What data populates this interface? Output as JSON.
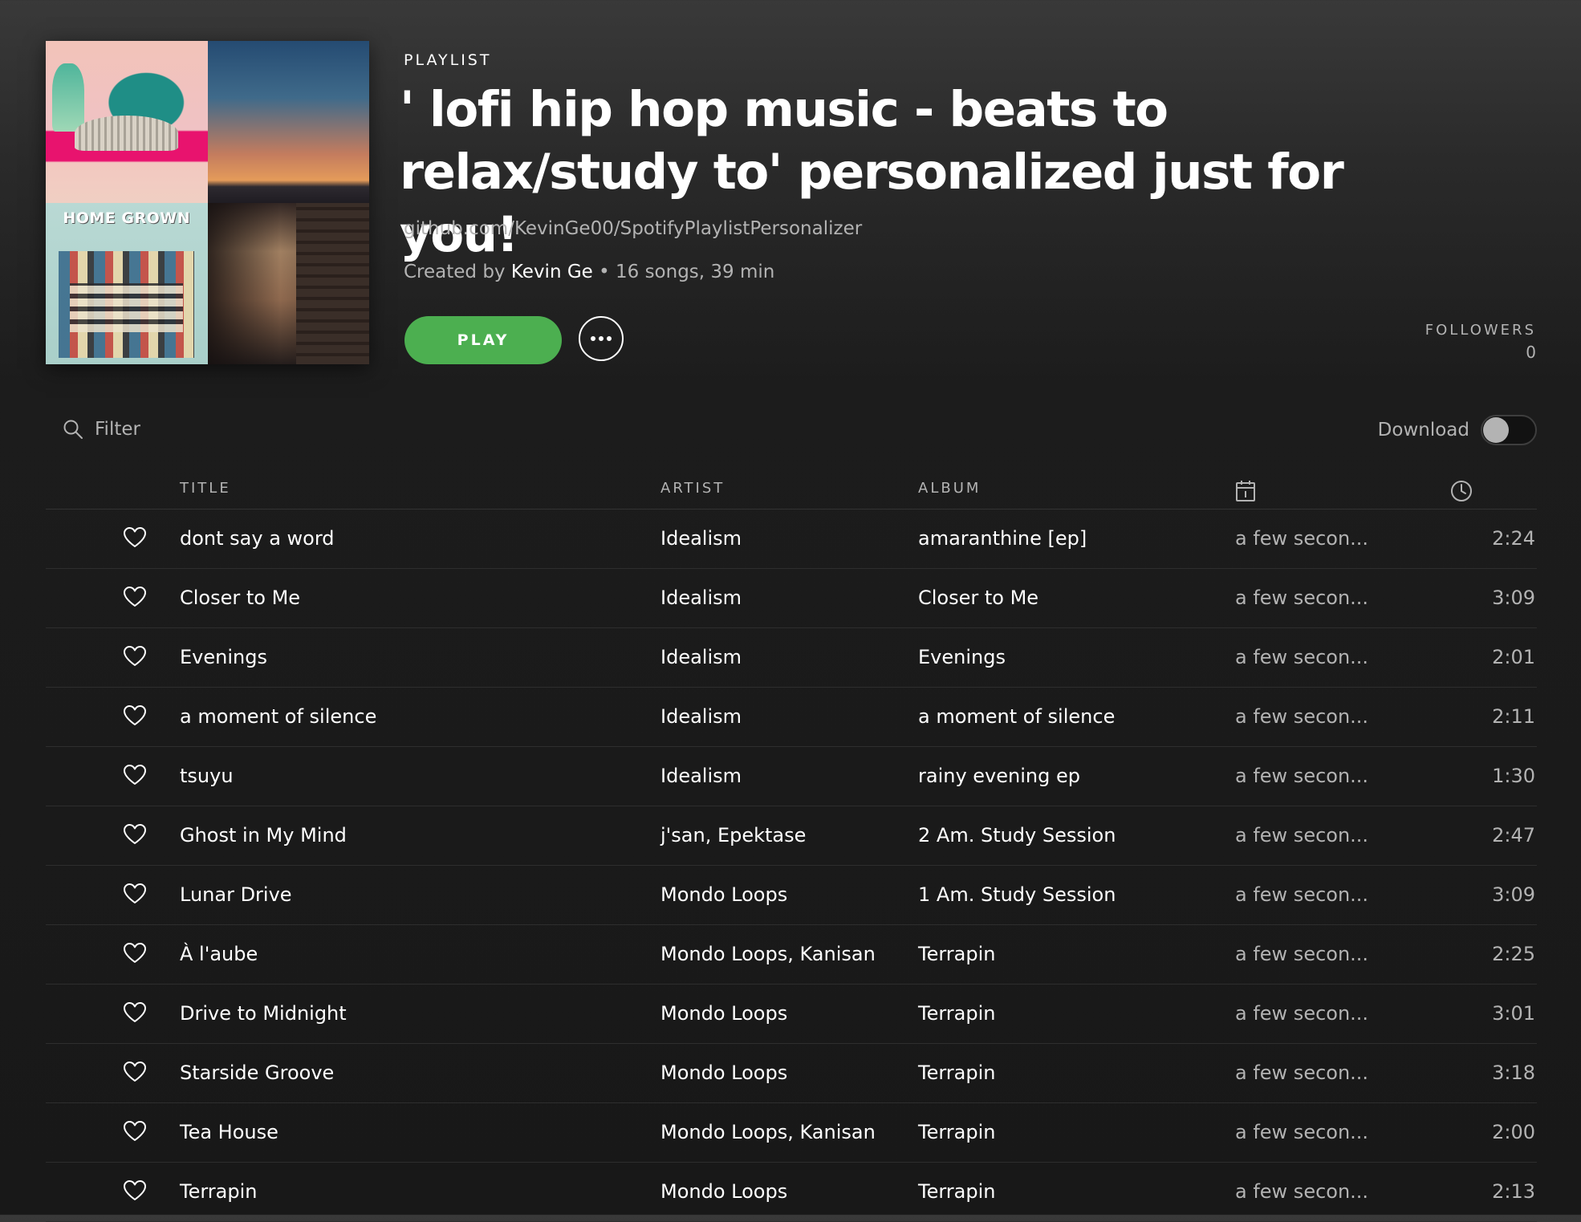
{
  "header": {
    "type_label": "PLAYLIST",
    "title": "' lofi hip hop music - beats to relax/study to' personalized just for you!",
    "description": "github.com/KevinGe00/SpotifyPlaylistPersonalizer",
    "created_by_prefix": "Created by ",
    "creator": "Kevin Ge",
    "stats": " • 16 songs, 39 min",
    "cover_logo": "HOME GROWN",
    "play_label": "PLAY",
    "followers_label": "FOLLOWERS",
    "followers_count": "0"
  },
  "filter": {
    "placeholder": "Filter"
  },
  "download": {
    "label": "Download",
    "enabled": false
  },
  "columns": {
    "title": "TITLE",
    "artist": "ARTIST",
    "album": "ALBUM",
    "added_icon": "calendar-icon",
    "duration_icon": "clock-icon"
  },
  "tracks": [
    {
      "title": "dont say a word",
      "artist": "Idealism",
      "album": "amaranthine [ep]",
      "added": "a few secon...",
      "duration": "2:24"
    },
    {
      "title": "Closer to Me",
      "artist": "Idealism",
      "album": "Closer to Me",
      "added": "a few secon...",
      "duration": "3:09"
    },
    {
      "title": "Evenings",
      "artist": "Idealism",
      "album": "Evenings",
      "added": "a few secon...",
      "duration": "2:01"
    },
    {
      "title": "a moment of silence",
      "artist": "Idealism",
      "album": "a moment of silence",
      "added": "a few secon...",
      "duration": "2:11"
    },
    {
      "title": "tsuyu",
      "artist": "Idealism",
      "album": "rainy evening ep",
      "added": "a few secon...",
      "duration": "1:30"
    },
    {
      "title": "Ghost in My Mind",
      "artist": "j'san, Epektase",
      "album": "2 Am. Study Session",
      "added": "a few secon...",
      "duration": "2:47"
    },
    {
      "title": "Lunar Drive",
      "artist": "Mondo Loops",
      "album": "1 Am. Study Session",
      "added": "a few secon...",
      "duration": "3:09"
    },
    {
      "title": "À l'aube",
      "artist": "Mondo Loops, Kanisan",
      "album": "Terrapin",
      "added": "a few secon...",
      "duration": "2:25"
    },
    {
      "title": "Drive to Midnight",
      "artist": "Mondo Loops",
      "album": "Terrapin",
      "added": "a few secon...",
      "duration": "3:01"
    },
    {
      "title": "Starside Groove",
      "artist": "Mondo Loops",
      "album": "Terrapin",
      "added": "a few secon...",
      "duration": "3:18"
    },
    {
      "title": "Tea House",
      "artist": "Mondo Loops, Kanisan",
      "album": "Terrapin",
      "added": "a few secon...",
      "duration": "2:00"
    },
    {
      "title": "Terrapin",
      "artist": "Mondo Loops",
      "album": "Terrapin",
      "added": "a few secon...",
      "duration": "2:13"
    }
  ],
  "colors": {
    "accent": "#4caf50",
    "text_primary": "#ffffff",
    "text_secondary": "#b3b3b3",
    "background": "#181818"
  }
}
